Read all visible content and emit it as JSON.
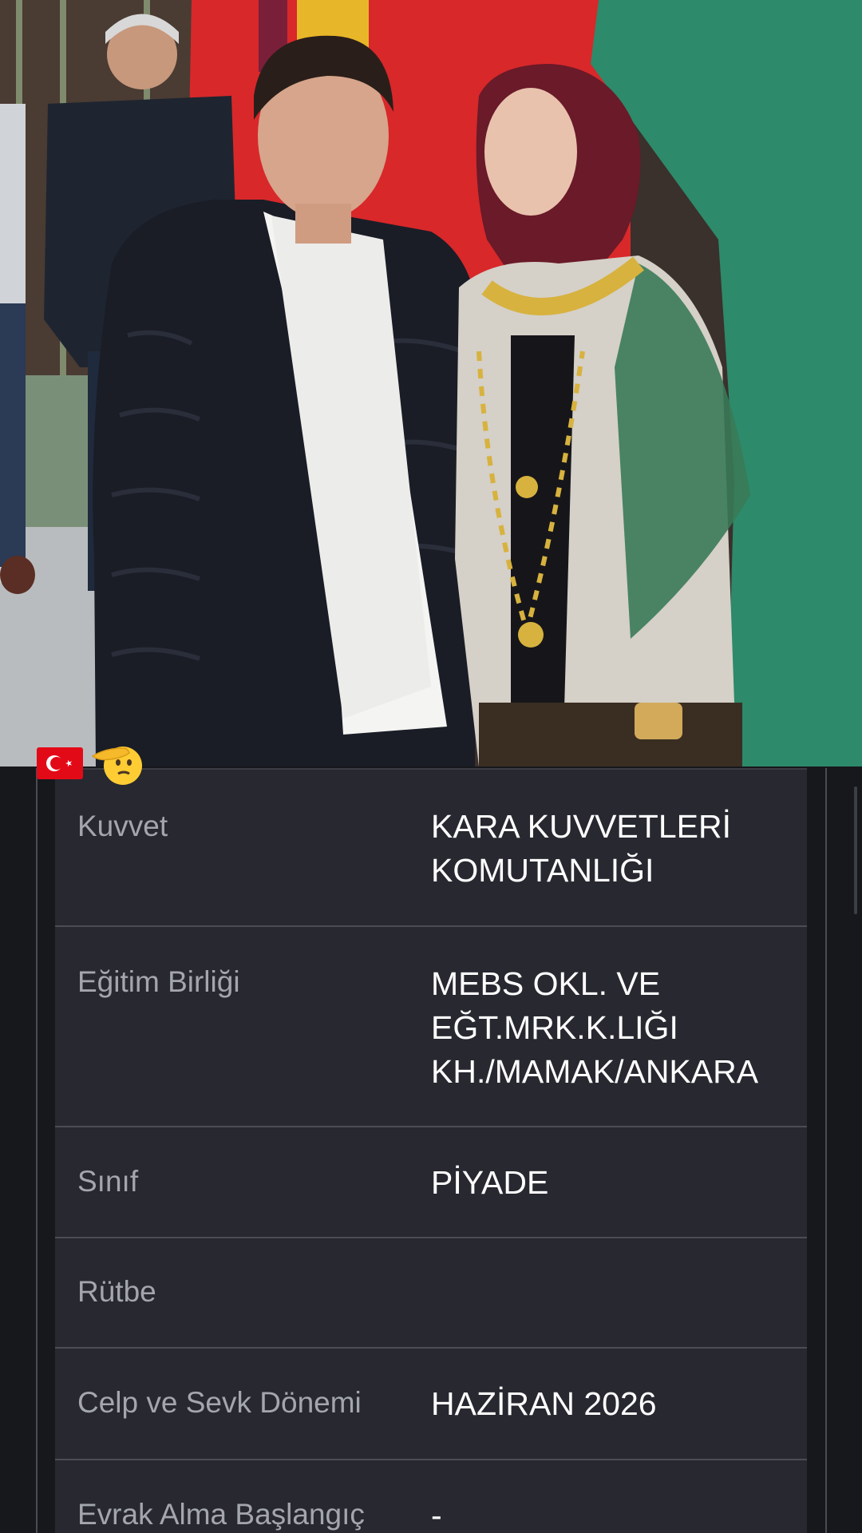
{
  "photo": {
    "description_icon": "photo-couple",
    "emojis": [
      "turkish-flag-icon",
      "saluting-face-icon"
    ]
  },
  "details": [
    {
      "label": "Kuvvet",
      "value": "KARA KUVVETLERİ\nKOMUTANLIĞI"
    },
    {
      "label": "Eğitim Birliği",
      "value": "MEBS OKL. VE\nEĞT.MRK.K.LIĞI\nKH./MAMAK/ANKARA"
    },
    {
      "label": "Sınıf",
      "value": "PİYADE"
    },
    {
      "label": "Rütbe",
      "value": ""
    },
    {
      "label": "Celp ve Sevk Dönemi",
      "value": "HAZİRAN 2026"
    },
    {
      "label": "Evrak Alma Başlangıç",
      "value": "-"
    }
  ],
  "colors": {
    "background": "#17181c",
    "card": "#272830",
    "divider": "#4b4d55",
    "label": "#a4a6ad",
    "value": "#ffffff"
  }
}
